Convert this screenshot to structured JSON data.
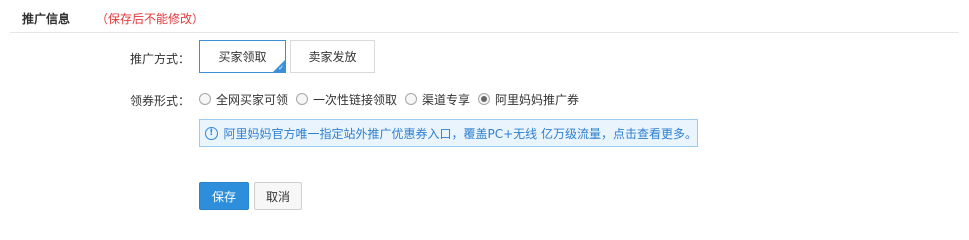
{
  "header": {
    "title": "推广信息",
    "note": "（保存后不能修改）"
  },
  "form": {
    "mode_label": "推广方式：",
    "mode_options": [
      {
        "label": "买家领取",
        "selected": true
      },
      {
        "label": "卖家发放",
        "selected": false
      }
    ],
    "coupon_form_label": "领券形式：",
    "coupon_forms": [
      {
        "label": "全网买家可领",
        "checked": false
      },
      {
        "label": "一次性链接领取",
        "checked": false
      },
      {
        "label": "渠道专享",
        "checked": false
      },
      {
        "label": "阿里妈妈推广券",
        "checked": true
      }
    ],
    "info": {
      "icon": "info-circle-icon",
      "text": "阿里妈妈官方唯一指定站外推广优惠券入口，覆盖PC+无线 亿万级流量，点击查看更多。"
    }
  },
  "actions": {
    "save_label": "保存",
    "cancel_label": "取消"
  },
  "colors": {
    "accent": "#2d8fdc",
    "note_red": "#e4393c",
    "info_bg": "#e9f4fc",
    "info_border": "#9ccbf0"
  }
}
